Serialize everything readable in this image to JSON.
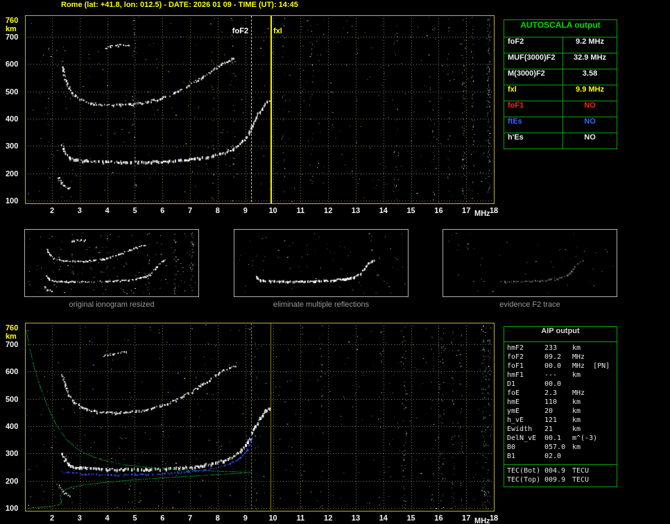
{
  "window": {
    "title": "Rome (lat: +41.8, lon: 012.5) - DATE: 2026 01 09 - TIME (UT): 14:45"
  },
  "colors": {
    "background": "#000000",
    "title_yellow": "#ffff00",
    "tick_white": "#f0f0f0",
    "grid": "#7d7d46",
    "plot_border": "#b9b91c",
    "table_green": "#00aa00",
    "header_green": "#00dd00",
    "value_red": "#ff2020",
    "value_blue": "#3a66ff",
    "profile_green": "#00c846",
    "restored_blue": "#3448f0"
  },
  "autoscala": {
    "header": "AUTOSCALA output",
    "rows": [
      {
        "label": "foF2",
        "value": "9.2 MHz",
        "color": "#f0f0f0"
      },
      {
        "label": "MUF(3000)F2",
        "value": "32.9 MHz",
        "color": "#f0f0f0"
      },
      {
        "label": "M(3000)F2",
        "value": "3.58",
        "color": "#f0f0f0"
      },
      {
        "label": "fxl",
        "value": "9.9 MHz",
        "color": "#ffff00"
      },
      {
        "label": "foF1",
        "value": "NO",
        "color": "#ff2020"
      },
      {
        "label": "ftEs",
        "value": "NO",
        "color": "#3a66ff"
      },
      {
        "label": "h'Es",
        "value": "NO",
        "color": "#f0f0f0"
      }
    ]
  },
  "aip": {
    "header": "AIP output",
    "rows": [
      {
        "name": "hmF2",
        "value": "233",
        "unit": "km"
      },
      {
        "name": "foF2",
        "value": "09.2",
        "unit": "MHz"
      },
      {
        "name": "foF1",
        "value": "00.0",
        "unit": "MHz  [PN]"
      },
      {
        "name": "hmF1",
        "value": "---",
        "unit": "km"
      },
      {
        "name": "D1",
        "value": "00.0",
        "unit": ""
      },
      {
        "name": "foE",
        "value": "2.3",
        "unit": "MHz"
      },
      {
        "name": "hmE",
        "value": "110",
        "unit": "km"
      },
      {
        "name": "ymE",
        "value": "20",
        "unit": "km"
      },
      {
        "name": "h_vE",
        "value": "121",
        "unit": "km"
      },
      {
        "name": "Ewidth",
        "value": "21",
        "unit": "km"
      },
      {
        "name": "DelN_vE",
        "value": "00.1",
        "unit": "m^(-3)"
      },
      {
        "name": "B0",
        "value": "057.0",
        "unit": "km"
      },
      {
        "name": "B1",
        "value": "02.0",
        "unit": ""
      }
    ],
    "tec_rows": [
      {
        "name": "TEC(Bot)",
        "value": "004.9",
        "unit": "TECU"
      },
      {
        "name": "TEC(Top)",
        "value": "009.9",
        "unit": "TECU"
      }
    ]
  },
  "thumbnails": [
    {
      "caption": "original ionogram resized",
      "mode": "all"
    },
    {
      "caption": "eliminate multiple reflections",
      "mode": "main"
    },
    {
      "caption": "evidence F2 trace",
      "mode": "faint"
    }
  ],
  "chart_data": [
    {
      "id": "top-ionogram",
      "type": "scatter",
      "title": "recorded ionogram with AUTOSCALA markers",
      "xlabel": "MHz",
      "ylabel": "km",
      "xlim": [
        1.02,
        18.0
      ],
      "ylim": [
        90,
        779
      ],
      "xticks": [
        2,
        3,
        4,
        5,
        6,
        7,
        8,
        9,
        10,
        11,
        12,
        13,
        14,
        15,
        16,
        17,
        18
      ],
      "yticks": [
        100,
        200,
        300,
        400,
        500,
        600,
        700
      ],
      "ytop": 760,
      "grid": true,
      "foF2_MHz": 9.2,
      "foF2_label": "foF2",
      "fxI_MHz": 9.9,
      "fxI_label": "fxl",
      "noise_dots": 430,
      "noise_columns": 22,
      "traces": [
        {
          "name": "F2-first-hop",
          "color": "#ffffff",
          "size": 3.5,
          "points": [
            [
              2.35,
              300
            ],
            [
              2.45,
              272
            ],
            [
              2.6,
              256
            ],
            [
              2.85,
              248
            ],
            [
              3.2,
              244
            ],
            [
              3.8,
              241
            ],
            [
              4.6,
              240
            ],
            [
              5.4,
              240
            ],
            [
              6.1,
              242
            ],
            [
              6.8,
              247
            ],
            [
              7.3,
              253
            ],
            [
              7.8,
              262
            ],
            [
              8.2,
              273
            ],
            [
              8.55,
              288
            ],
            [
              8.8,
              305
            ],
            [
              9.0,
              328
            ],
            [
              9.15,
              355
            ],
            [
              9.3,
              390
            ],
            [
              9.5,
              425
            ],
            [
              9.7,
              452
            ],
            [
              9.85,
              464
            ]
          ]
        },
        {
          "name": "F2-second-hop",
          "color": "#ffffff",
          "size": 2.5,
          "points": [
            [
              2.35,
              590
            ],
            [
              2.45,
              545
            ],
            [
              2.6,
              510
            ],
            [
              2.8,
              483
            ],
            [
              3.1,
              464
            ],
            [
              3.6,
              452
            ],
            [
              4.2,
              448
            ],
            [
              4.8,
              451
            ],
            [
              5.4,
              459
            ],
            [
              5.9,
              472
            ],
            [
              6.4,
              492
            ],
            [
              6.9,
              518
            ],
            [
              7.4,
              549
            ],
            [
              7.9,
              583
            ],
            [
              8.3,
              610
            ],
            [
              8.6,
              621
            ]
          ]
        },
        {
          "name": "F2-third-hop-fragment",
          "color": "#ffffff",
          "size": 2,
          "points": [
            [
              3.85,
              656
            ],
            [
              4.1,
              664
            ],
            [
              4.5,
              669
            ],
            [
              4.8,
              668
            ]
          ]
        },
        {
          "name": "E-region-fragment",
          "color": "#ffffff",
          "size": 2,
          "points": [
            [
              2.2,
              185
            ],
            [
              2.3,
              168
            ],
            [
              2.45,
              152
            ],
            [
              2.62,
              144
            ]
          ]
        }
      ]
    },
    {
      "id": "bottom-ionogram",
      "type": "scatter",
      "title": "ionogram with restored trace and electron density profile",
      "xlabel": "MHz",
      "ylabel": "km",
      "xlim": [
        1.02,
        18.0
      ],
      "ylim": [
        90,
        779
      ],
      "xticks": [
        2,
        3,
        4,
        5,
        6,
        7,
        8,
        9,
        10,
        11,
        12,
        13,
        14,
        15,
        16,
        17,
        18
      ],
      "yticks": [
        100,
        200,
        300,
        400,
        500,
        600,
        700
      ],
      "ytop": 760,
      "grid": true,
      "foF2_MHz": 9.2,
      "fxI_MHz": 9.9,
      "noise_dots": 400,
      "noise_columns": 20,
      "traces": [
        {
          "name": "F2-first-hop",
          "color": "#ffffff",
          "size": 3.5,
          "points": [
            [
              2.35,
              300
            ],
            [
              2.45,
              272
            ],
            [
              2.6,
              256
            ],
            [
              2.85,
              248
            ],
            [
              3.2,
              244
            ],
            [
              3.8,
              241
            ],
            [
              4.6,
              240
            ],
            [
              5.4,
              240
            ],
            [
              6.1,
              242
            ],
            [
              6.8,
              247
            ],
            [
              7.3,
              253
            ],
            [
              7.8,
              262
            ],
            [
              8.2,
              273
            ],
            [
              8.55,
              288
            ],
            [
              8.8,
              305
            ],
            [
              9.0,
              328
            ],
            [
              9.15,
              355
            ],
            [
              9.3,
              390
            ],
            [
              9.5,
              425
            ],
            [
              9.7,
              452
            ],
            [
              9.85,
              464
            ]
          ]
        },
        {
          "name": "F2-second-hop",
          "color": "#ffffff",
          "size": 2.5,
          "points": [
            [
              2.35,
              590
            ],
            [
              2.45,
              545
            ],
            [
              2.6,
              510
            ],
            [
              2.8,
              483
            ],
            [
              3.1,
              464
            ],
            [
              3.6,
              452
            ],
            [
              4.2,
              448
            ],
            [
              4.8,
              451
            ],
            [
              5.4,
              459
            ],
            [
              5.9,
              472
            ],
            [
              6.4,
              492
            ],
            [
              6.9,
              518
            ],
            [
              7.4,
              549
            ],
            [
              7.9,
              583
            ],
            [
              8.3,
              610
            ],
            [
              8.6,
              621
            ]
          ]
        },
        {
          "name": "F2-third-hop-fragment",
          "color": "#ffffff",
          "size": 2,
          "points": [
            [
              3.85,
              656
            ],
            [
              4.1,
              664
            ],
            [
              4.5,
              669
            ],
            [
              4.8,
              668
            ]
          ]
        },
        {
          "name": "E-region-fragment",
          "color": "#ffffff",
          "size": 2,
          "points": [
            [
              2.2,
              185
            ],
            [
              2.3,
              168
            ],
            [
              2.45,
              152
            ],
            [
              2.62,
              144
            ]
          ]
        }
      ],
      "profile": {
        "name": "electron-density-profile",
        "color": "#00c846",
        "points": [
          [
            1.05,
            752
          ],
          [
            1.2,
            678
          ],
          [
            1.35,
            614
          ],
          [
            1.55,
            549
          ],
          [
            1.8,
            480
          ],
          [
            2.1,
            414
          ],
          [
            2.5,
            354
          ],
          [
            3.0,
            310
          ],
          [
            3.7,
            280
          ],
          [
            4.6,
            260
          ],
          [
            5.7,
            248
          ],
          [
            7.0,
            240
          ],
          [
            8.2,
            235
          ],
          [
            9.2,
            233
          ],
          [
            8.8,
            229
          ],
          [
            8.0,
            224
          ],
          [
            7.0,
            218
          ],
          [
            6.0,
            212
          ],
          [
            5.0,
            205
          ],
          [
            4.0,
            196
          ],
          [
            3.2,
            187
          ],
          [
            2.7,
            178
          ],
          [
            2.45,
            168
          ],
          [
            2.33,
            156
          ],
          [
            2.28,
            144
          ],
          [
            2.31,
            133
          ],
          [
            2.33,
            124
          ],
          [
            2.29,
            117
          ],
          [
            2.2,
            112
          ],
          [
            1.9,
            107
          ],
          [
            1.5,
            104
          ],
          [
            1.15,
            101
          ]
        ]
      },
      "restored_trace": {
        "name": "restored-F2-trace",
        "color": "#3448f0",
        "points": [
          [
            2.3,
            232
          ],
          [
            2.7,
            227
          ],
          [
            3.3,
            223
          ],
          [
            4.0,
            221
          ],
          [
            4.8,
            221
          ],
          [
            5.6,
            223
          ],
          [
            6.3,
            227
          ],
          [
            6.9,
            232
          ],
          [
            7.5,
            239
          ],
          [
            8.0,
            249
          ],
          [
            8.4,
            261
          ],
          [
            8.7,
            276
          ],
          [
            8.9,
            293
          ],
          [
            9.05,
            313
          ],
          [
            9.15,
            335
          ],
          [
            9.22,
            356
          ]
        ]
      }
    }
  ]
}
